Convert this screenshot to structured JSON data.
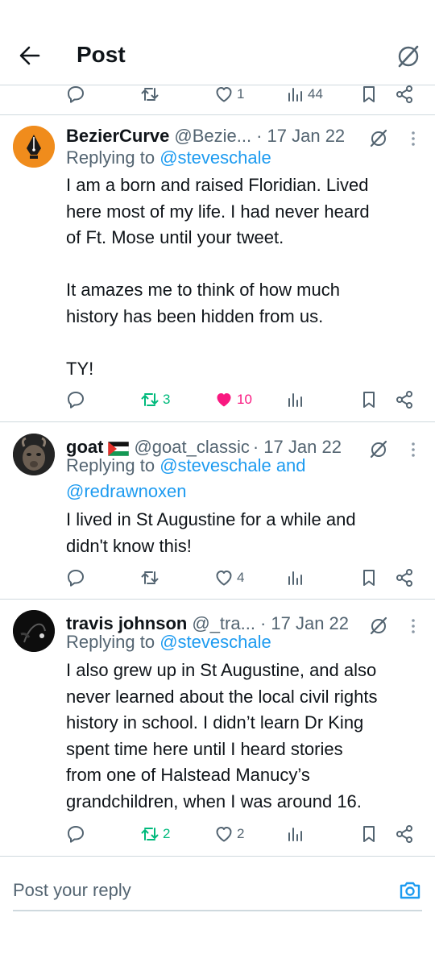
{
  "header": {
    "title": "Post",
    "back_icon": "arrow-left-icon",
    "grok_icon": "grok-slash-icon"
  },
  "top_actions": {
    "reply": "",
    "repost": "",
    "like": "1",
    "views": "44"
  },
  "tweets": [
    {
      "name": "BezierCurve",
      "handle": "@Bezie...",
      "time": "· 17 Jan 22",
      "replying_prefix": "Replying to ",
      "replying_to": "@steveschale",
      "replying_join": "",
      "replying_to_2": "",
      "text": "I am a born and raised Floridian. Lived\nhere most of my life. I had never heard\nof Ft. Mose until your tweet.\n\nIt amazes me to think of how much\nhistory has been hidden from us.\n\nTY!",
      "actions": {
        "reply": "",
        "repost": "3",
        "like": "10",
        "views": ""
      },
      "avatar_color": "#f08c1c"
    },
    {
      "name": "goat",
      "flag": "palestine-flag",
      "handle": "@goat_classic",
      "time": "· 17 Jan 22",
      "replying_prefix": "Replying to ",
      "replying_to": "@steveschale",
      "replying_join": " and",
      "replying_to_2": "@redrawnoxen",
      "text": "I lived in St Augustine for a while and\ndidn't know this!",
      "actions": {
        "reply": "",
        "repost": "",
        "like": "4",
        "views": ""
      }
    },
    {
      "name": "travis johnson",
      "handle": "@_tra...",
      "time": "· 17 Jan 22",
      "replying_prefix": "Replying to ",
      "replying_to": "@steveschale",
      "replying_join": "",
      "replying_to_2": "",
      "text": "I also grew up in St Augustine, and also\nnever learned about the local civil rights\nhistory in school. I didn’t learn Dr King\nspent time here until I heard stories\nfrom one of Halstead Manucy’s\ngrandchildren, when I was around 16.",
      "actions": {
        "reply": "",
        "repost": "2",
        "like": "2",
        "views": ""
      }
    }
  ],
  "composer": {
    "placeholder": "Post your reply",
    "camera_icon": "camera-icon"
  },
  "colors": {
    "accent": "#1d9bf0",
    "repost_green": "#00ba7c",
    "like_pink": "#f91880",
    "secondary": "#536471"
  }
}
